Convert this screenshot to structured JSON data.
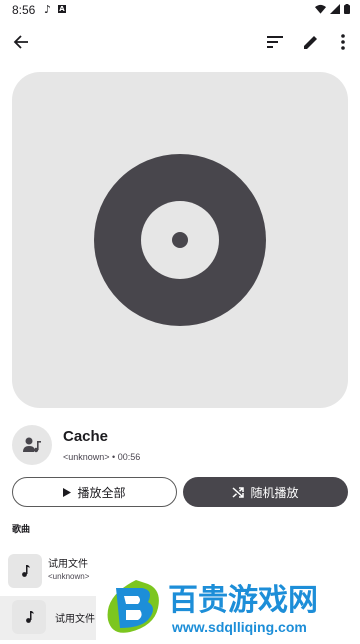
{
  "status_bar": {
    "time": "8:56",
    "icons": [
      "music-note-icon",
      "a-badge-icon",
      "wifi-icon",
      "signal-icon",
      "battery-icon"
    ]
  },
  "toolbar": {
    "icons": [
      "back-arrow-icon",
      "sort-icon",
      "edit-pencil-icon",
      "more-vert-icon"
    ]
  },
  "playlist": {
    "title": "Cache",
    "meta": "<unknown> • 00:56"
  },
  "actions": {
    "play_all": "播放全部",
    "shuffle": "随机播放"
  },
  "section": {
    "label": "歌曲"
  },
  "songs": [
    {
      "title": "试用文件",
      "artist": "<unknown>"
    },
    {
      "title": "试用文件",
      "artist": ""
    }
  ],
  "watermark": {
    "brand": "百贵游戏网",
    "url": "www.sdqlliqing.com"
  },
  "colors": {
    "card_bg": "#e6e6e6",
    "disc": "#48464c",
    "filled_button": "#48464c",
    "text": "#1c1b1f"
  }
}
